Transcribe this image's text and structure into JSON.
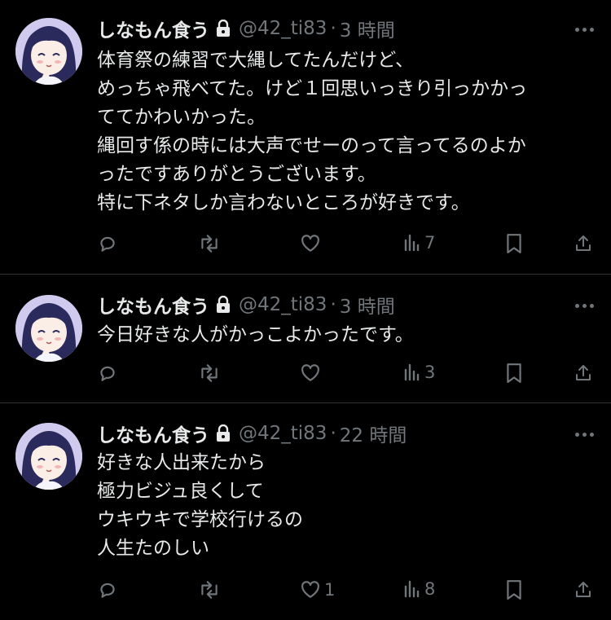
{
  "tweets": [
    {
      "name": "しなもん食う",
      "handle": "@42_ti83",
      "sep": "·",
      "time": "3 時間",
      "lines": [
        "体育祭の練習で大縄してたんだけど、",
        "めっちゃ飛べてた。けど１回思いっきり引っかかっ",
        "ててかわいかった。",
        "縄回す係の時には大声でせーのって言ってるのよか",
        "ったですありがとうございます。",
        "特に下ネタしか言わないところが好きです。"
      ],
      "likes": "",
      "views": "7"
    },
    {
      "name": "しなもん食う",
      "handle": "@42_ti83",
      "sep": "·",
      "time": "3 時間",
      "lines": [
        "今日好きな人がかっこよかったです。"
      ],
      "likes": "",
      "views": "3"
    },
    {
      "name": "しなもん食う",
      "handle": "@42_ti83",
      "sep": "·",
      "time": "22 時間",
      "lines": [
        "好きな人出来たから",
        "極力ビジュ良くして",
        "ウキウキで学校行けるの",
        "人生たのしい"
      ],
      "likes": "1",
      "views": "8"
    }
  ],
  "icons": {
    "lock": "lock-icon",
    "more": "more-icon",
    "reply": "reply-icon",
    "retweet": "retweet-icon",
    "like": "heart-icon",
    "views": "views-icon",
    "bookmark": "bookmark-icon",
    "share": "share-icon"
  },
  "colors": {
    "background": "#000000",
    "text": "#e7e9ea",
    "muted": "#71767b",
    "divider": "#2f3336"
  }
}
